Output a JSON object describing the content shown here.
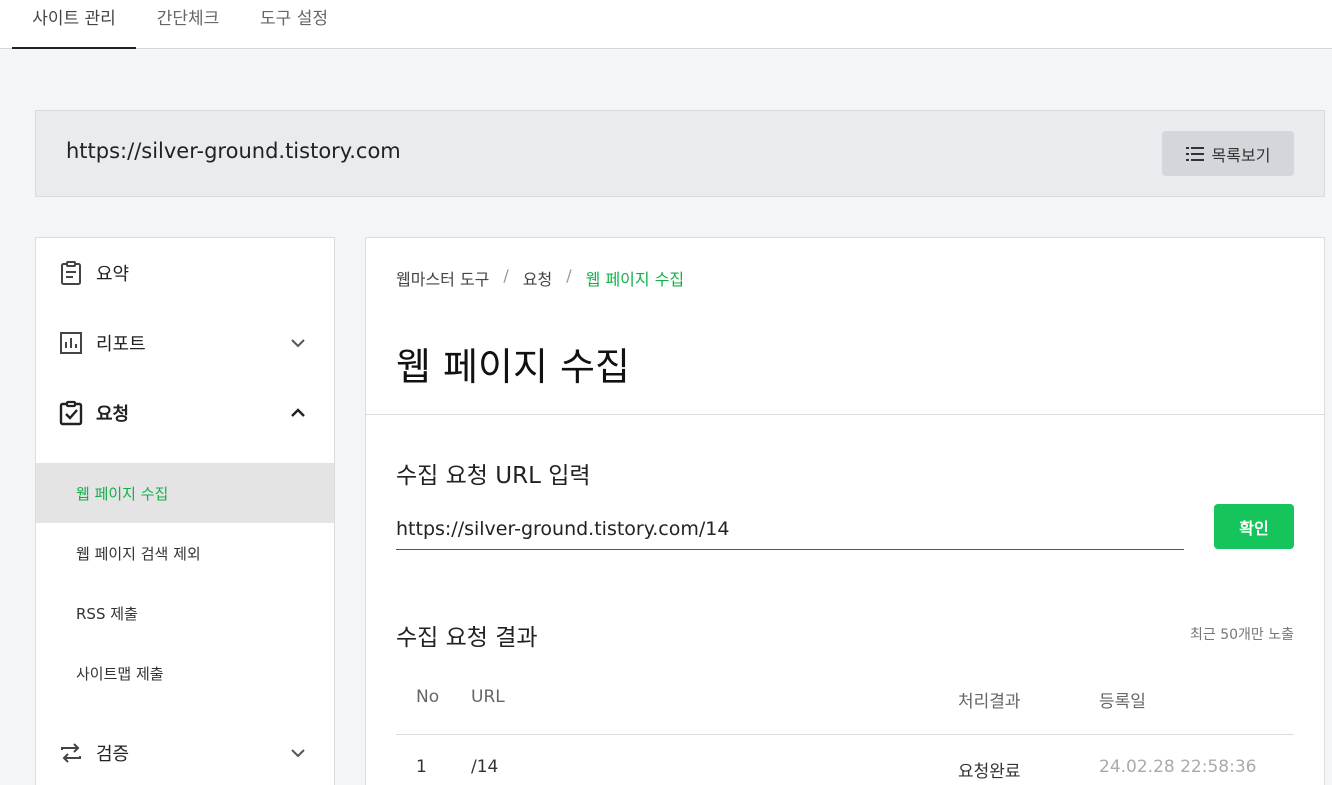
{
  "topnav": {
    "tabs": [
      "사이트 관리",
      "간단체크",
      "도구 설정"
    ]
  },
  "site": {
    "url": "https://silver-ground.tistory.com",
    "list_button": "목록보기"
  },
  "sidebar": {
    "menus": [
      {
        "label": "요약",
        "icon": "clipboard-icon"
      },
      {
        "label": "리포트",
        "icon": "bar-chart-icon"
      },
      {
        "label": "요청",
        "icon": "clipboard-check-icon"
      },
      {
        "label": "검증",
        "icon": "repeat-arrows-icon"
      }
    ],
    "subitems": [
      "웹 페이지 수집",
      "웹 페이지 검색 제외",
      "RSS 제출",
      "사이트맵 제출"
    ]
  },
  "breadcrumb": {
    "items": [
      "웹마스터 도구",
      "요청",
      "웹 페이지 수집"
    ],
    "separator": "/"
  },
  "page": {
    "title": "웹 페이지 수집",
    "input_section_title": "수집 요청 URL 입력",
    "input_value": "https://silver-ground.tistory.com/14",
    "confirm_button": "확인",
    "result_section_title": "수집 요청 결과",
    "recent_note": "최근 50개만 노출"
  },
  "table": {
    "headers": [
      "No",
      "URL",
      "처리결과",
      "등록일"
    ],
    "rows": [
      {
        "no": "1",
        "url": "/14",
        "status": "요청완료",
        "date": "24.02.28 22:58:36"
      }
    ]
  },
  "colors": {
    "accent": "#11b04a",
    "button": "#15c45a"
  }
}
